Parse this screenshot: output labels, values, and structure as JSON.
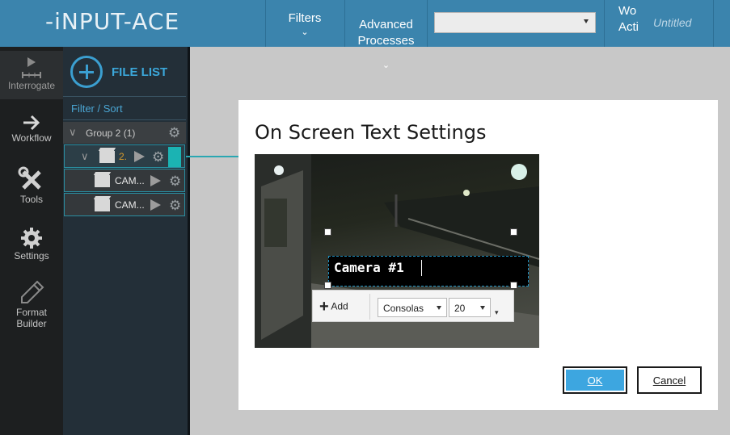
{
  "app": {
    "logo": "-iNPUT-ACE",
    "document_title": "Untitled"
  },
  "topbar": {
    "menus": [
      {
        "label": "Filters"
      },
      {
        "label": "Advanced\nProcesses"
      }
    ],
    "workspace_label": "Wo\nActi",
    "combo_value": ""
  },
  "leftnav": {
    "items": [
      {
        "label": "Interrogate",
        "icon": "play-timeline-icon"
      },
      {
        "label": "Workflow",
        "icon": "arrow-right-icon"
      },
      {
        "label": "Tools",
        "icon": "tools-icon"
      },
      {
        "label": "Settings",
        "icon": "gear-icon"
      },
      {
        "label": "Format Builder",
        "icon": "pencil-icon"
      }
    ]
  },
  "filepanel": {
    "title": "FILE LIST",
    "filter_sort": "Filter / Sort",
    "group": {
      "label": "Group 2 (1)"
    },
    "rows": [
      {
        "label": "2."
      },
      {
        "label": "CAM..."
      },
      {
        "label": "CAM..."
      }
    ]
  },
  "dialog": {
    "title": "On Screen Text Settings",
    "overlay_text": "Camera #1",
    "toolbar": {
      "add_label": "Add",
      "font_value": "Consolas",
      "size_value": "20"
    },
    "ok_label": "OK",
    "cancel_label": "Cancel"
  },
  "colors": {
    "topbar": "#3b84ad",
    "accent": "#3ba7da",
    "ok_button": "#3da6e0",
    "teal": "#1bb3b3"
  }
}
